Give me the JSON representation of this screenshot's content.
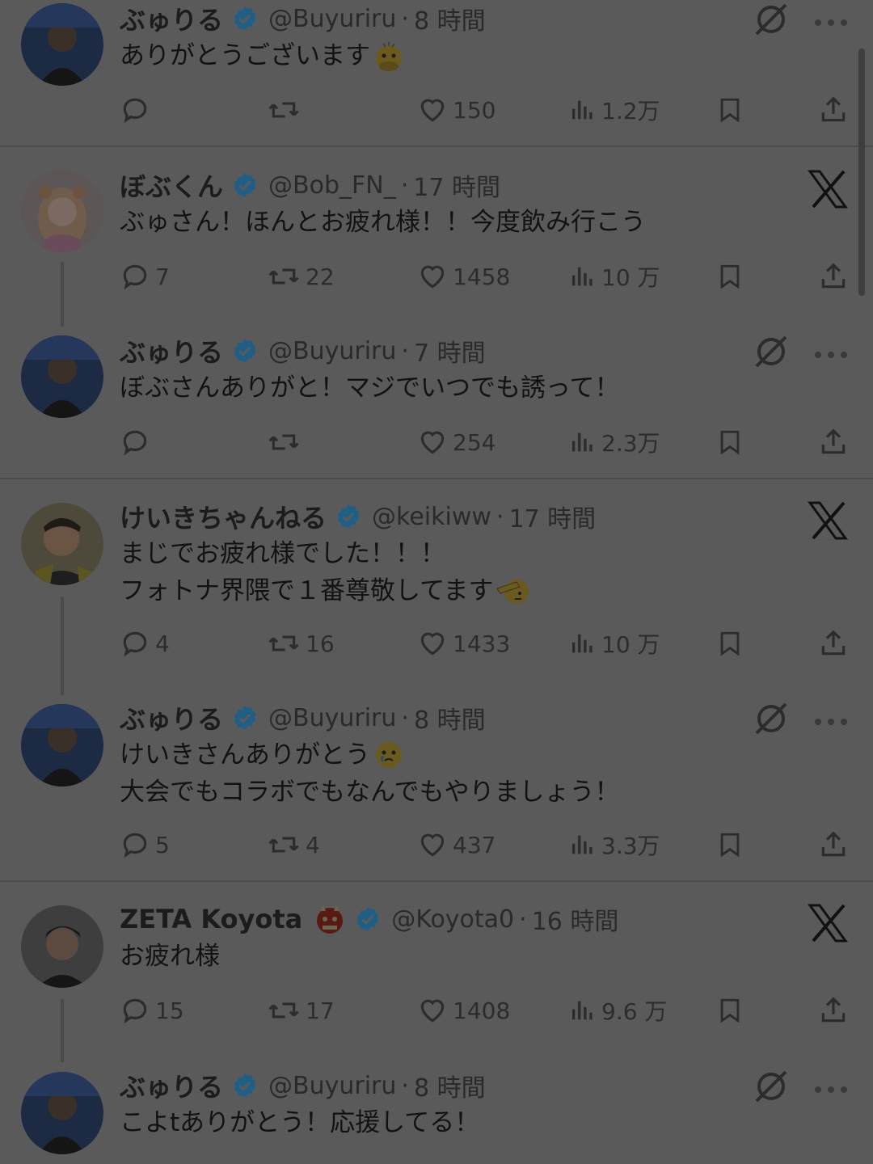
{
  "tweets": [
    {
      "name": "ぶゅりる",
      "handle": "@Buyuriru",
      "time": "8 時間",
      "lines": [
        "ありがとうございます"
      ],
      "trailing_emoji": "face-with-open-eyes-and-hand-over-mouth-emoji",
      "reply": "",
      "retweet": "",
      "like": "150",
      "views": "1.2万",
      "corner": "grok"
    },
    {
      "name": "ぼぶくん",
      "handle": "@Bob_FN_",
      "time": "17 時間",
      "lines": [
        "ぶゅさん！ほんとお疲れ様！！今度飲み行こう"
      ],
      "reply": "7",
      "retweet": "22",
      "like": "1458",
      "views": "10 万",
      "corner": "x"
    },
    {
      "name": "ぶゅりる",
      "handle": "@Buyuriru",
      "time": "7 時間",
      "lines": [
        "ぼぶさんありがと！マジでいつでも誘って！"
      ],
      "reply": "",
      "retweet": "",
      "like": "254",
      "views": "2.3万",
      "corner": "grok"
    },
    {
      "name": "けいきちゃんねる",
      "handle": "@keikiww",
      "time": "17 時間",
      "lines": [
        "まじでお疲れ様でした！！！",
        "フォトナ界隈で１番尊敬してます"
      ],
      "trailing_emoji": "saluting-face-emoji",
      "reply": "4",
      "retweet": "16",
      "like": "1433",
      "views": "10 万",
      "corner": "x"
    },
    {
      "name": "ぶゅりる",
      "handle": "@Buyuriru",
      "time": "8 時間",
      "lines": [
        "けいきさんありがとう",
        "大会でもコラボでもなんでもやりましょう！"
      ],
      "line1_emoji": "face-holding-back-tears-emoji",
      "reply": "5",
      "retweet": "4",
      "like": "437",
      "views": "3.3万",
      "corner": "grok"
    },
    {
      "name": "ZETA Koyota",
      "handle": "@Koyota0",
      "time": "16 時間",
      "lines": [
        "お疲れ様"
      ],
      "name_emoji": "ogre-emoji",
      "reply": "15",
      "retweet": "17",
      "like": "1408",
      "views": "9.6 万",
      "corner": "x"
    },
    {
      "name": "ぶゅりる",
      "handle": "@Buyuriru",
      "time": "8 時間",
      "lines": [
        "こよtありがとう！応援してる！"
      ],
      "corner": "grok"
    }
  ],
  "dot": "·",
  "colors": {
    "overlay": "#5a5a5a",
    "verified": "#1f5f86"
  }
}
